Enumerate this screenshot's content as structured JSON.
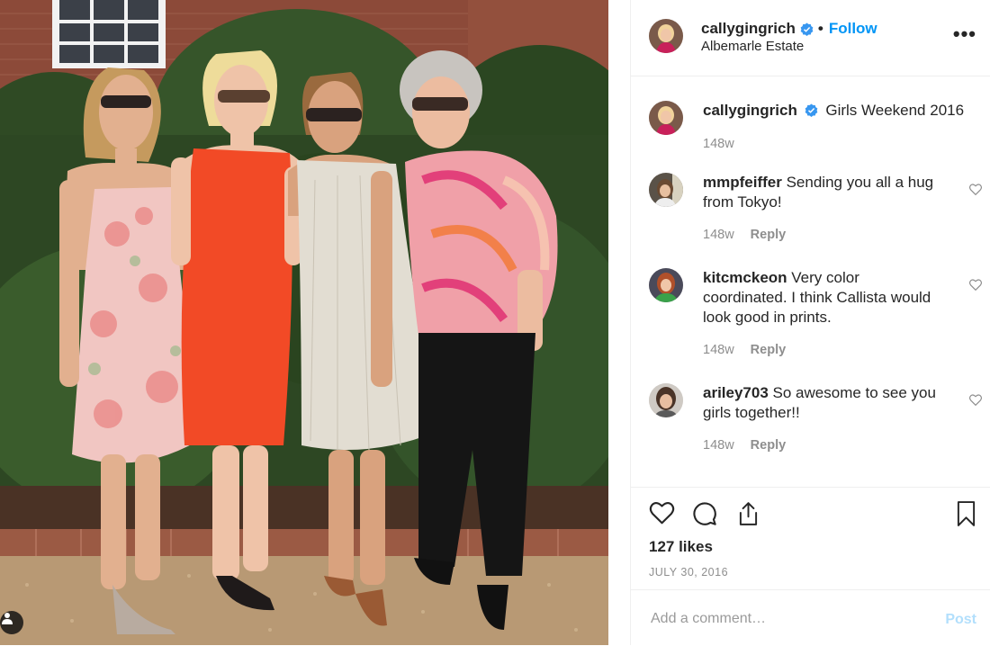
{
  "post": {
    "image_alt": "Four women standing together outdoors in front of a brick building and hedges",
    "tag_icon": "person-tag-icon"
  },
  "header": {
    "username": "callygingrich",
    "verified_icon": "verified-badge-icon",
    "separator": "•",
    "follow_label": "Follow",
    "location": "Albemarle Estate",
    "more_label": "•••"
  },
  "caption": {
    "username": "callygingrich",
    "text": "Girls Weekend 2016",
    "time": "148w"
  },
  "comments": [
    {
      "username": "mmpfeiffer",
      "text": "Sending you all a hug from Tokyo!",
      "time": "148w",
      "reply_label": "Reply"
    },
    {
      "username": "kitcmckeon",
      "text": "Very color coordinated. I think Callista would look good in prints.",
      "time": "148w",
      "reply_label": "Reply"
    },
    {
      "username": "ariley703",
      "text": "So awesome to see you girls together!!",
      "time": "148w",
      "reply_label": "Reply"
    }
  ],
  "actions": {
    "like_icon": "heart-icon",
    "comment_icon": "comment-bubble-icon",
    "share_icon": "share-icon",
    "save_icon": "bookmark-icon",
    "likes": "127 likes",
    "date": "JULY 30, 2016"
  },
  "composer": {
    "placeholder": "Add a comment…",
    "post_label": "Post"
  },
  "colors": {
    "link_blue": "#0095f6",
    "post_disabled": "#b2dffc",
    "meta_gray": "#8e8e8e",
    "text": "#262626"
  }
}
